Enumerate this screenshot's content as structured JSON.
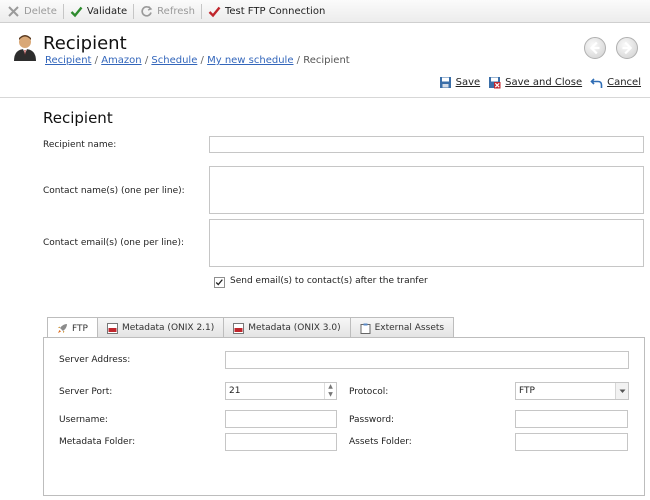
{
  "toolbar": {
    "delete_label": "Delete",
    "validate_label": "Validate",
    "refresh_label": "Refresh",
    "test_ftp_label": "Test FTP Connection"
  },
  "header": {
    "title": "Recipient",
    "breadcrumb": [
      "Recipient",
      "Amazon",
      "Schedule",
      "My new schedule",
      "Recipient"
    ],
    "breadcrumb_separator": "/"
  },
  "actions": {
    "save_label": "Save",
    "save_close_label": "Save and Close",
    "cancel_label": "Cancel"
  },
  "form": {
    "section_title": "Recipient",
    "recipient_name_label": "Recipient name:",
    "recipient_name_value": "",
    "contact_names_label": "Contact name(s) (one per line):",
    "contact_names_value": "",
    "contact_emails_label": "Contact email(s) (one per line):",
    "contact_emails_value": "",
    "send_email_label": "Send email(s) to contact(s) after the tranfer",
    "send_email_checked": true
  },
  "tabs": [
    {
      "label": "FTP",
      "active": true
    },
    {
      "label": "Metadata (ONIX 2.1)",
      "active": false
    },
    {
      "label": "Metadata (ONIX 3.0)",
      "active": false
    },
    {
      "label": "External Assets",
      "active": false
    }
  ],
  "ftp": {
    "server_address_label": "Server Address:",
    "server_address_value": "",
    "server_port_label": "Server Port:",
    "server_port_value": "21",
    "protocol_label": "Protocol:",
    "protocol_value": "FTP",
    "username_label": "Username:",
    "username_value": "",
    "password_label": "Password:",
    "password_value": "",
    "metadata_folder_label": "Metadata Folder:",
    "metadata_folder_value": "",
    "assets_folder_label": "Assets Folder:",
    "assets_folder_value": ""
  },
  "colors": {
    "link": "#3366bb",
    "validate_check": "#2e8b2e",
    "test_ftp_check": "#c0262c"
  }
}
